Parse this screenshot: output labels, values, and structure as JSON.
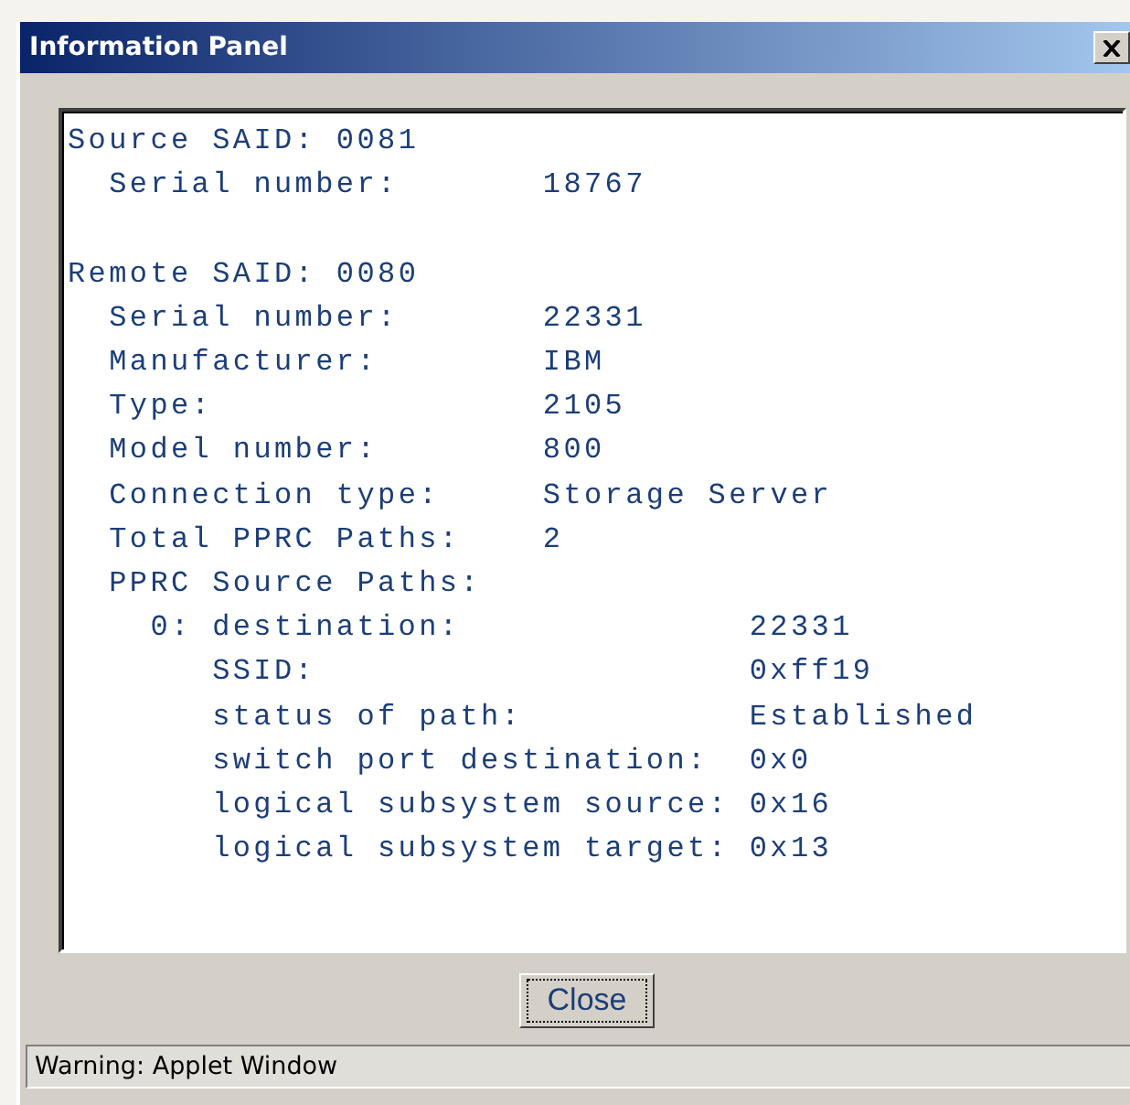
{
  "window": {
    "title": "Information Panel"
  },
  "sections": [
    {
      "heading": "Source SAID: 0081",
      "fields": [
        {
          "label": "Serial number:",
          "value": "18767"
        }
      ]
    },
    {
      "heading": "Remote SAID: 0080",
      "fields": [
        {
          "label": "Serial number:",
          "value": "22331"
        },
        {
          "label": "Manufacturer:",
          "value": "IBM"
        },
        {
          "label": "Type:",
          "value": "2105"
        },
        {
          "label": "Model number:",
          "value": "800"
        },
        {
          "label": "Connection type:",
          "value": "Storage Server"
        },
        {
          "label": "Total PPRC Paths:",
          "value": "2"
        }
      ],
      "paths_heading": "PPRC Source Paths:",
      "paths": [
        {
          "index": "0:",
          "fields": [
            {
              "label": "destination:",
              "value": "22331"
            },
            {
              "label": "SSID:",
              "value": "0xff19"
            },
            {
              "label": "status of path:",
              "value": "Established"
            },
            {
              "label": "switch port destination:",
              "value": "0x0"
            },
            {
              "label": "logical subsystem source:",
              "value": "0x16"
            },
            {
              "label": "logical subsystem target:",
              "value": "0x13"
            }
          ]
        }
      ]
    }
  ],
  "buttons": [
    "Close"
  ],
  "status_bar": "Warning: Applet Window"
}
